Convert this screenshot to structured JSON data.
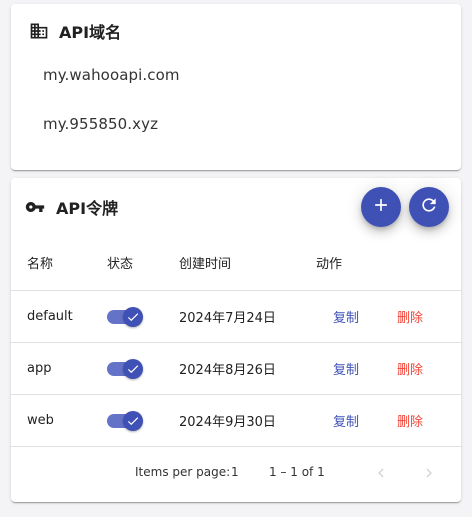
{
  "domain_card": {
    "title": "API域名",
    "domains": [
      "my.wahooapi.com",
      "my.955850.xyz"
    ]
  },
  "token_card": {
    "title": "API令牌",
    "columns": {
      "name": "名称",
      "status": "状态",
      "created": "创建时间",
      "action": "动作"
    },
    "rows": [
      {
        "name": "default",
        "enabled": true,
        "created": "2024年7月24日",
        "copy": "复制",
        "delete": "删除"
      },
      {
        "name": "app",
        "enabled": true,
        "created": "2024年8月26日",
        "copy": "复制",
        "delete": "删除"
      },
      {
        "name": "web",
        "enabled": true,
        "created": "2024年9月30日",
        "copy": "复制",
        "delete": "删除"
      }
    ],
    "paginator": {
      "label": "Items per page:",
      "page_size": "1",
      "range": "1 – 1 of 1"
    }
  },
  "colors": {
    "primary": "#3f51b5",
    "warn": "#f44336"
  },
  "icons": {
    "domain": "building-icon",
    "token": "key-icon",
    "add": "plus-icon",
    "refresh": "refresh-icon",
    "prev": "chevron-left-icon",
    "next": "chevron-right-icon"
  }
}
